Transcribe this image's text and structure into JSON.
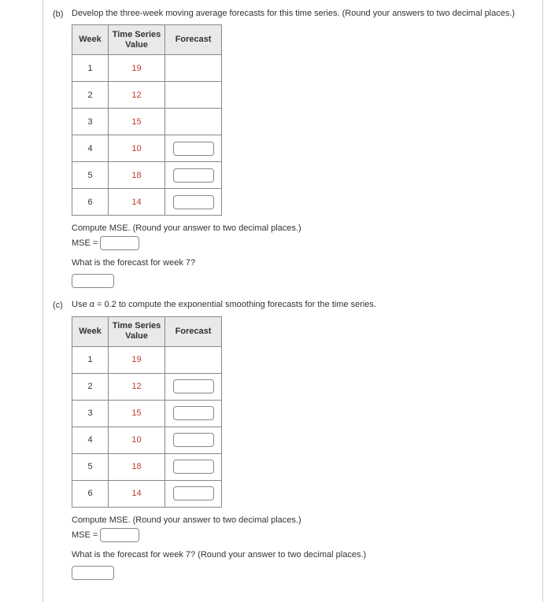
{
  "parts": {
    "b": {
      "label": "(b)",
      "prompt": "Develop the three-week moving average forecasts for this time series. (Round your answers to two decimal places.)",
      "table": {
        "headers": {
          "week": "Week",
          "ts": "Time Series\nValue",
          "fc": "Forecast"
        },
        "rows": [
          {
            "week": "1",
            "ts": "19",
            "fc_input": false
          },
          {
            "week": "2",
            "ts": "12",
            "fc_input": false
          },
          {
            "week": "3",
            "ts": "15",
            "fc_input": false
          },
          {
            "week": "4",
            "ts": "10",
            "fc_input": true
          },
          {
            "week": "5",
            "ts": "18",
            "fc_input": true
          },
          {
            "week": "6",
            "ts": "14",
            "fc_input": true
          }
        ]
      },
      "mse_prompt": "Compute MSE. (Round your answer to two decimal places.)",
      "mse_label": "MSE =",
      "wk7_prompt": "What is the forecast for week 7?"
    },
    "c": {
      "label": "(c)",
      "prompt": "Use α = 0.2 to compute the exponential smoothing forecasts for the time series.",
      "table": {
        "headers": {
          "week": "Week",
          "ts": "Time Series\nValue",
          "fc": "Forecast"
        },
        "rows": [
          {
            "week": "1",
            "ts": "19",
            "fc_input": false
          },
          {
            "week": "2",
            "ts": "12",
            "fc_input": true
          },
          {
            "week": "3",
            "ts": "15",
            "fc_input": true
          },
          {
            "week": "4",
            "ts": "10",
            "fc_input": true
          },
          {
            "week": "5",
            "ts": "18",
            "fc_input": true
          },
          {
            "week": "6",
            "ts": "14",
            "fc_input": true
          }
        ]
      },
      "mse_prompt": "Compute MSE. (Round your answer to two decimal places.)",
      "mse_label": "MSE =",
      "wk7_prompt": "What is the forecast for week 7? (Round your answer to two decimal places.)"
    }
  }
}
